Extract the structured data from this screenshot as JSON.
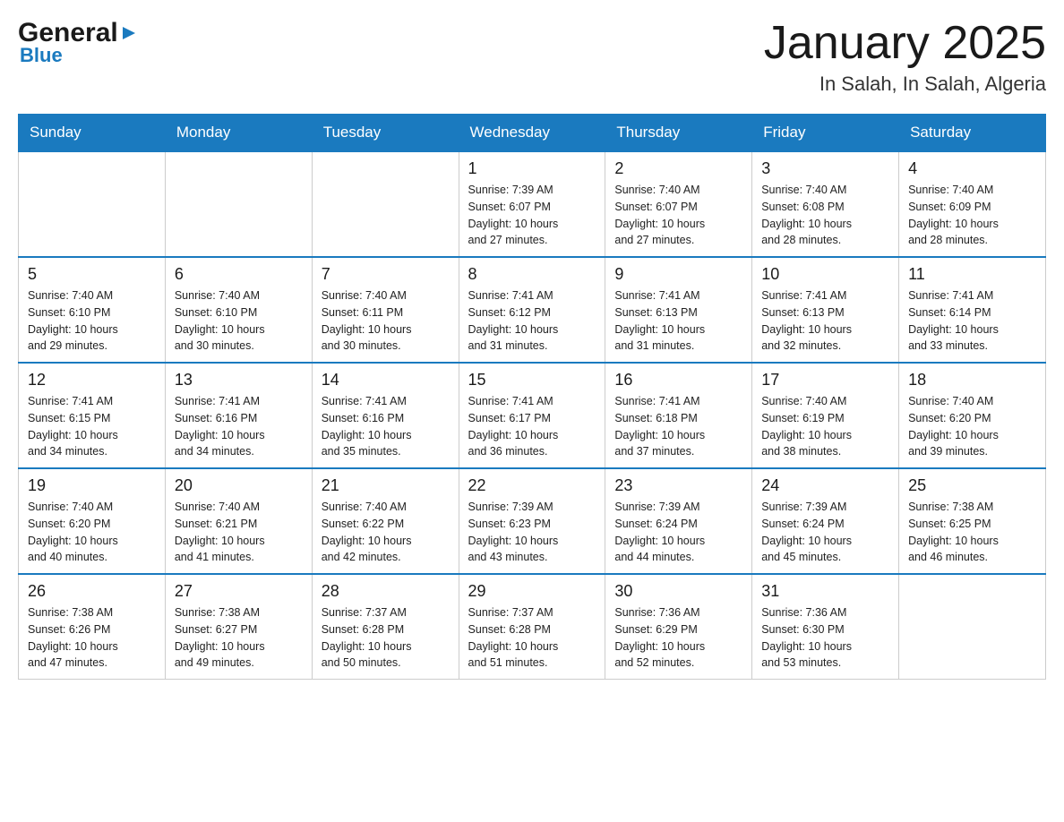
{
  "logo": {
    "general": "General",
    "blue": "Blue",
    "arrow": "▶"
  },
  "header": {
    "month": "January 2025",
    "location": "In Salah, In Salah, Algeria"
  },
  "weekdays": [
    "Sunday",
    "Monday",
    "Tuesday",
    "Wednesday",
    "Thursday",
    "Friday",
    "Saturday"
  ],
  "weeks": [
    [
      {
        "day": "",
        "info": ""
      },
      {
        "day": "",
        "info": ""
      },
      {
        "day": "",
        "info": ""
      },
      {
        "day": "1",
        "info": "Sunrise: 7:39 AM\nSunset: 6:07 PM\nDaylight: 10 hours\nand 27 minutes."
      },
      {
        "day": "2",
        "info": "Sunrise: 7:40 AM\nSunset: 6:07 PM\nDaylight: 10 hours\nand 27 minutes."
      },
      {
        "day": "3",
        "info": "Sunrise: 7:40 AM\nSunset: 6:08 PM\nDaylight: 10 hours\nand 28 minutes."
      },
      {
        "day": "4",
        "info": "Sunrise: 7:40 AM\nSunset: 6:09 PM\nDaylight: 10 hours\nand 28 minutes."
      }
    ],
    [
      {
        "day": "5",
        "info": "Sunrise: 7:40 AM\nSunset: 6:10 PM\nDaylight: 10 hours\nand 29 minutes."
      },
      {
        "day": "6",
        "info": "Sunrise: 7:40 AM\nSunset: 6:10 PM\nDaylight: 10 hours\nand 30 minutes."
      },
      {
        "day": "7",
        "info": "Sunrise: 7:40 AM\nSunset: 6:11 PM\nDaylight: 10 hours\nand 30 minutes."
      },
      {
        "day": "8",
        "info": "Sunrise: 7:41 AM\nSunset: 6:12 PM\nDaylight: 10 hours\nand 31 minutes."
      },
      {
        "day": "9",
        "info": "Sunrise: 7:41 AM\nSunset: 6:13 PM\nDaylight: 10 hours\nand 31 minutes."
      },
      {
        "day": "10",
        "info": "Sunrise: 7:41 AM\nSunset: 6:13 PM\nDaylight: 10 hours\nand 32 minutes."
      },
      {
        "day": "11",
        "info": "Sunrise: 7:41 AM\nSunset: 6:14 PM\nDaylight: 10 hours\nand 33 minutes."
      }
    ],
    [
      {
        "day": "12",
        "info": "Sunrise: 7:41 AM\nSunset: 6:15 PM\nDaylight: 10 hours\nand 34 minutes."
      },
      {
        "day": "13",
        "info": "Sunrise: 7:41 AM\nSunset: 6:16 PM\nDaylight: 10 hours\nand 34 minutes."
      },
      {
        "day": "14",
        "info": "Sunrise: 7:41 AM\nSunset: 6:16 PM\nDaylight: 10 hours\nand 35 minutes."
      },
      {
        "day": "15",
        "info": "Sunrise: 7:41 AM\nSunset: 6:17 PM\nDaylight: 10 hours\nand 36 minutes."
      },
      {
        "day": "16",
        "info": "Sunrise: 7:41 AM\nSunset: 6:18 PM\nDaylight: 10 hours\nand 37 minutes."
      },
      {
        "day": "17",
        "info": "Sunrise: 7:40 AM\nSunset: 6:19 PM\nDaylight: 10 hours\nand 38 minutes."
      },
      {
        "day": "18",
        "info": "Sunrise: 7:40 AM\nSunset: 6:20 PM\nDaylight: 10 hours\nand 39 minutes."
      }
    ],
    [
      {
        "day": "19",
        "info": "Sunrise: 7:40 AM\nSunset: 6:20 PM\nDaylight: 10 hours\nand 40 minutes."
      },
      {
        "day": "20",
        "info": "Sunrise: 7:40 AM\nSunset: 6:21 PM\nDaylight: 10 hours\nand 41 minutes."
      },
      {
        "day": "21",
        "info": "Sunrise: 7:40 AM\nSunset: 6:22 PM\nDaylight: 10 hours\nand 42 minutes."
      },
      {
        "day": "22",
        "info": "Sunrise: 7:39 AM\nSunset: 6:23 PM\nDaylight: 10 hours\nand 43 minutes."
      },
      {
        "day": "23",
        "info": "Sunrise: 7:39 AM\nSunset: 6:24 PM\nDaylight: 10 hours\nand 44 minutes."
      },
      {
        "day": "24",
        "info": "Sunrise: 7:39 AM\nSunset: 6:24 PM\nDaylight: 10 hours\nand 45 minutes."
      },
      {
        "day": "25",
        "info": "Sunrise: 7:38 AM\nSunset: 6:25 PM\nDaylight: 10 hours\nand 46 minutes."
      }
    ],
    [
      {
        "day": "26",
        "info": "Sunrise: 7:38 AM\nSunset: 6:26 PM\nDaylight: 10 hours\nand 47 minutes."
      },
      {
        "day": "27",
        "info": "Sunrise: 7:38 AM\nSunset: 6:27 PM\nDaylight: 10 hours\nand 49 minutes."
      },
      {
        "day": "28",
        "info": "Sunrise: 7:37 AM\nSunset: 6:28 PM\nDaylight: 10 hours\nand 50 minutes."
      },
      {
        "day": "29",
        "info": "Sunrise: 7:37 AM\nSunset: 6:28 PM\nDaylight: 10 hours\nand 51 minutes."
      },
      {
        "day": "30",
        "info": "Sunrise: 7:36 AM\nSunset: 6:29 PM\nDaylight: 10 hours\nand 52 minutes."
      },
      {
        "day": "31",
        "info": "Sunrise: 7:36 AM\nSunset: 6:30 PM\nDaylight: 10 hours\nand 53 minutes."
      },
      {
        "day": "",
        "info": ""
      }
    ]
  ]
}
